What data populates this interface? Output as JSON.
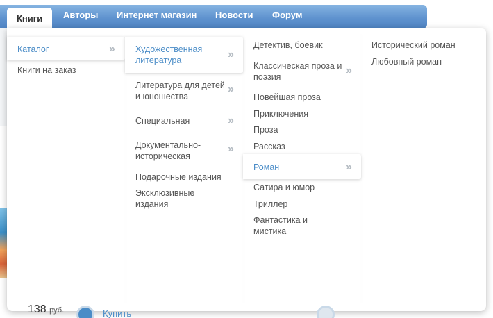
{
  "nav": {
    "items": [
      {
        "label": "Книги",
        "active": true
      },
      {
        "label": "Авторы"
      },
      {
        "label": "Интернет магазин"
      },
      {
        "label": "Новости"
      },
      {
        "label": "Форум"
      }
    ]
  },
  "menu": {
    "col1": [
      "Каталог",
      "Книги на заказ"
    ],
    "col2": [
      "Художественная литература",
      "Литература для детей и юношества",
      "Специальная",
      "Документально-историческая",
      "Подарочные издания",
      "Эксклюзивные издания"
    ],
    "col3": [
      "Детектив, боевик",
      "Классическая проза и поэзия",
      "Новейшая проза",
      "Приключения",
      "Проза",
      "Рассказ",
      "Роман",
      "Сатира и юмор",
      "Триллер",
      "Фантастика и мистика"
    ],
    "col4": [
      "Исторический роман",
      "Любовный роман"
    ],
    "chevron": "»"
  },
  "background": {
    "price1": "138",
    "price_unit": "руб.",
    "buy_label": "Купить"
  },
  "colors": {
    "nav_blue": "#5f93cf",
    "link_blue": "#4a8cc7"
  }
}
